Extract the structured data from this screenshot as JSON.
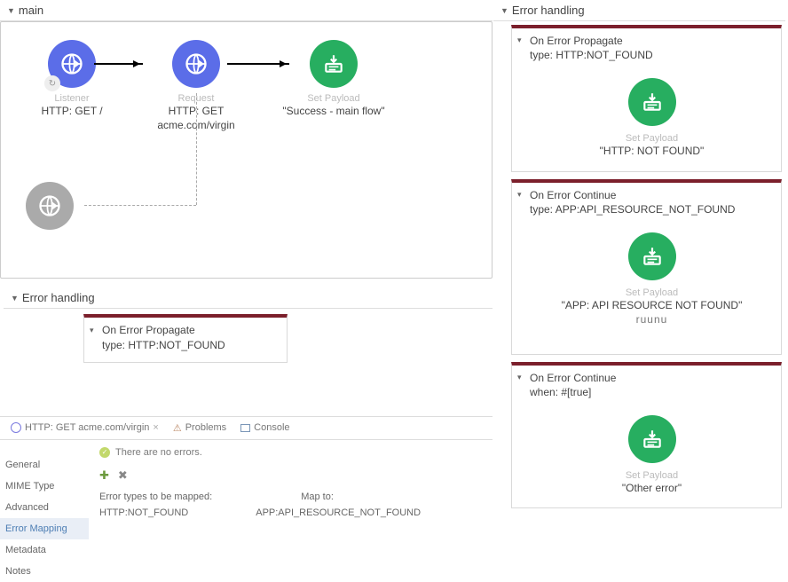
{
  "mainTitle": "main",
  "nodes": {
    "listener": {
      "dim": "Listener",
      "sub": "HTTP: GET /"
    },
    "request": {
      "dim": "Request",
      "sub": "HTTP: GET acme.com/virgin"
    },
    "payload": {
      "dim": "Set Payload",
      "sub": "\"Success - main flow\""
    }
  },
  "leftError": {
    "title": "Error handling",
    "handler": {
      "l1": "On Error Propagate",
      "l2": "type: HTTP:NOT_FOUND"
    }
  },
  "bottom": {
    "tab1": "HTTP: GET acme.com/virgin",
    "tab2": "Problems",
    "tab3": "Console",
    "noErrors": "There are no errors.",
    "nav": [
      "General",
      "MIME Type",
      "Advanced",
      "Error Mapping",
      "Metadata",
      "Notes"
    ],
    "col1": "Error types to be mapped:",
    "col2": "Map to:",
    "val1": "HTTP:NOT_FOUND",
    "val2": "APP:API_RESOURCE_NOT_FOUND"
  },
  "right": {
    "title": "Error handling",
    "h1": {
      "l1": "On Error Propagate",
      "l2": "type: HTTP:NOT_FOUND",
      "dim": "Set Payload",
      "val": "\"HTTP: NOT FOUND\""
    },
    "h2": {
      "l1": "On Error Continue",
      "l2": "type: APP:API_RESOURCE_NOT_FOUND",
      "dim": "Set Payload",
      "val": "\"APP: API RESOURCE NOT FOUND\"",
      "echo": "ruunu"
    },
    "h3": {
      "l1": "On Error Continue",
      "l2": "when: #[true]",
      "dim": "Set Payload",
      "val": "\"Other error\""
    }
  }
}
